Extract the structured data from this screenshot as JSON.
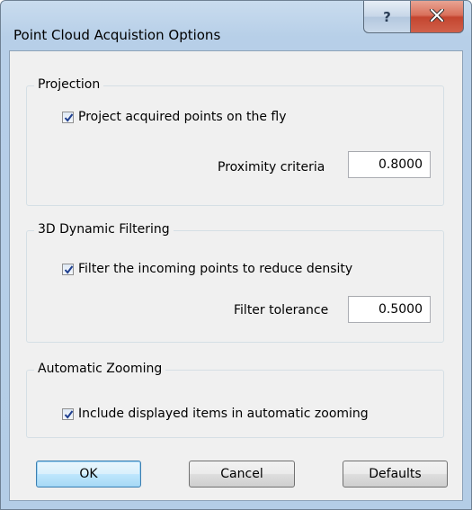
{
  "window": {
    "title": "Point Cloud Acquistion Options"
  },
  "titlebar": {
    "help_label": "?"
  },
  "projection": {
    "group_label": "Projection",
    "project_checkbox": {
      "label": "Project acquired points on the fly",
      "checked": true
    },
    "proximity": {
      "label": "Proximity criteria",
      "value": "0.8000"
    }
  },
  "filtering": {
    "group_label": "3D Dynamic Filtering",
    "filter_checkbox": {
      "label": "Filter the incoming points to reduce density",
      "checked": true
    },
    "tolerance": {
      "label": "Filter tolerance",
      "value": "0.5000"
    }
  },
  "zooming": {
    "group_label": "Automatic Zooming",
    "include_checkbox": {
      "label": "Include displayed items in automatic zooming",
      "checked": true
    }
  },
  "buttons": {
    "ok": "OK",
    "cancel": "Cancel",
    "defaults": "Defaults"
  }
}
